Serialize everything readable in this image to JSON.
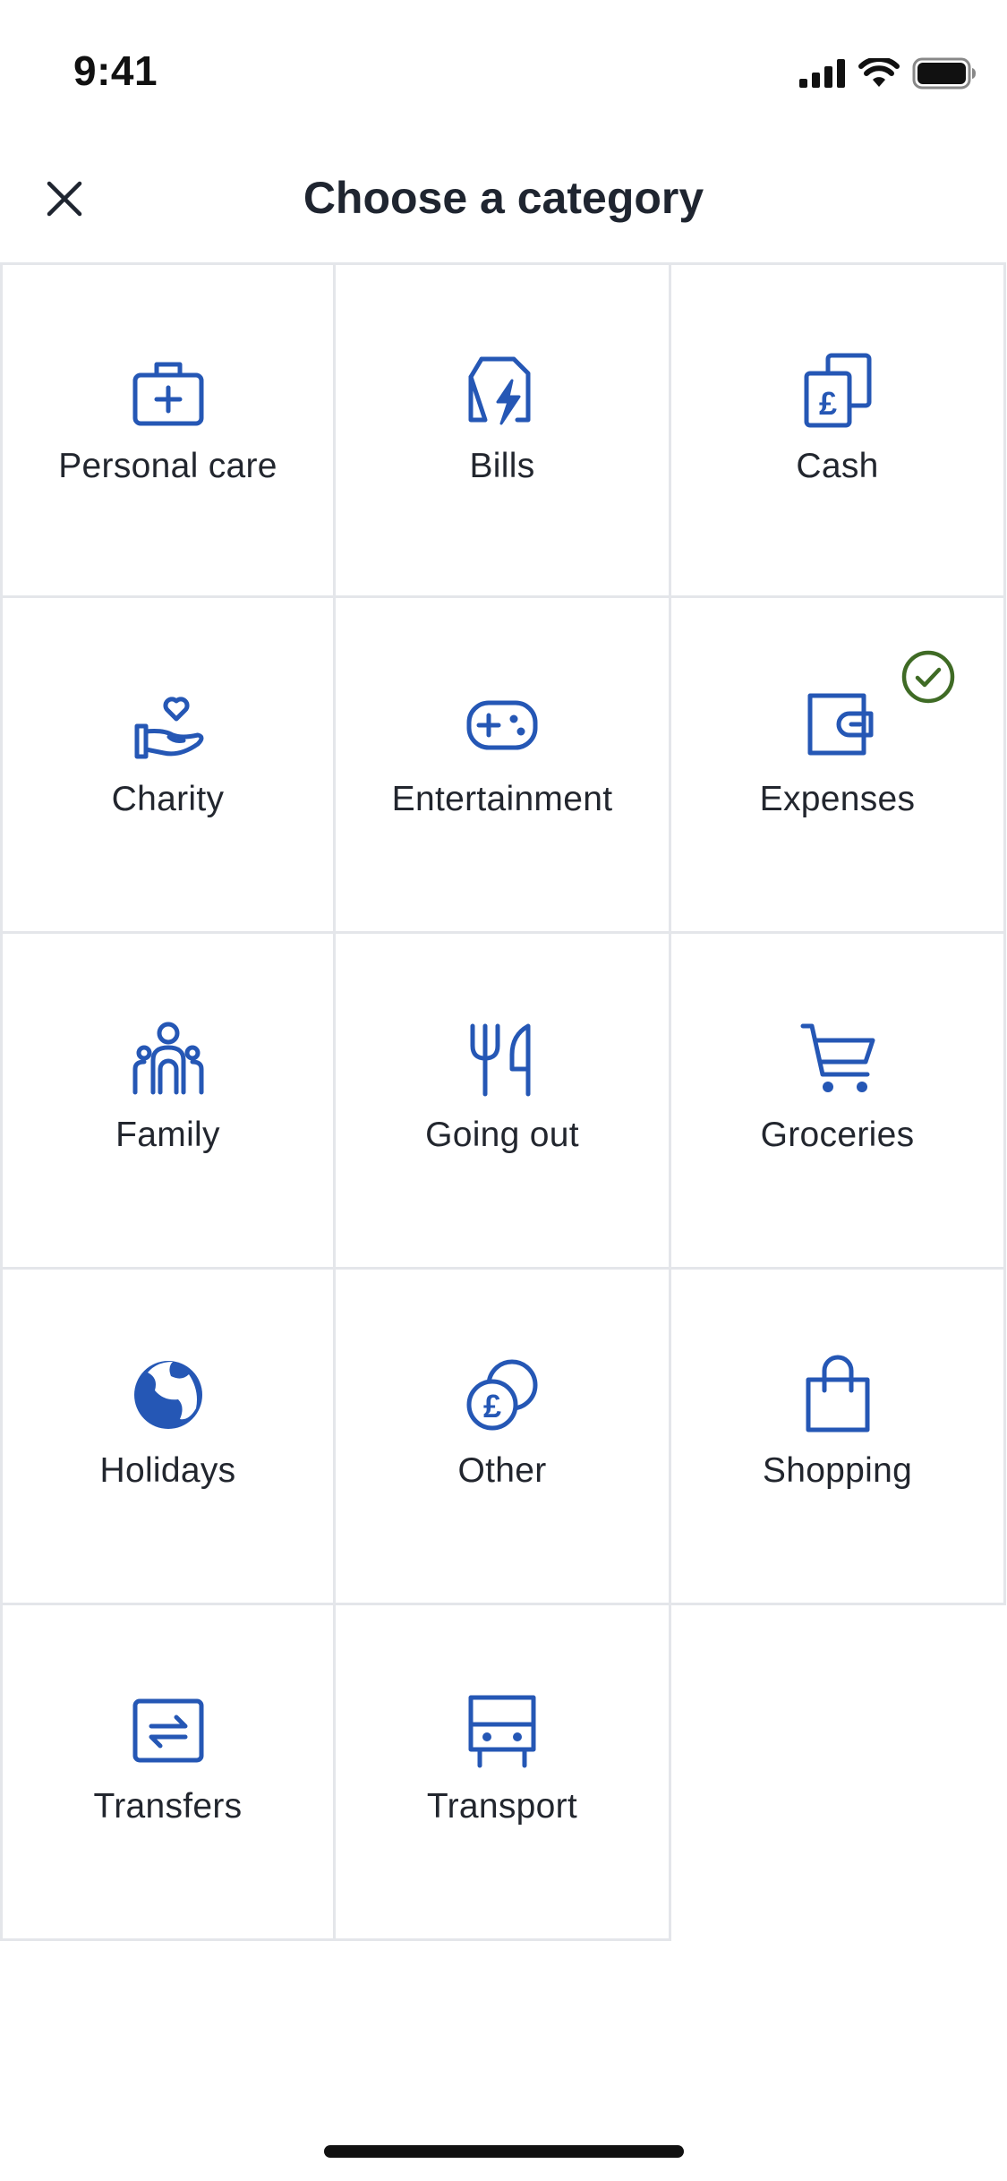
{
  "status_bar": {
    "time": "9:41"
  },
  "header": {
    "title": "Choose a category"
  },
  "colors": {
    "icon_blue": "#2557b5",
    "check_green": "#3f6b25",
    "grid_line": "#e4e6ea"
  },
  "categories": [
    {
      "label": "Personal care",
      "icon": "first-aid-kit-icon",
      "selected": false
    },
    {
      "label": "Bills",
      "icon": "bill-lightning-icon",
      "selected": false
    },
    {
      "label": "Cash",
      "icon": "pound-notes-icon",
      "selected": false
    },
    {
      "label": "Charity",
      "icon": "hand-heart-icon",
      "selected": false
    },
    {
      "label": "Entertainment",
      "icon": "game-controller-icon",
      "selected": false
    },
    {
      "label": "Expenses",
      "icon": "wallet-icon",
      "selected": true
    },
    {
      "label": "Family",
      "icon": "family-icon",
      "selected": false
    },
    {
      "label": "Going out",
      "icon": "fork-knife-icon",
      "selected": false
    },
    {
      "label": "Groceries",
      "icon": "shopping-cart-icon",
      "selected": false
    },
    {
      "label": "Holidays",
      "icon": "globe-icon",
      "selected": false
    },
    {
      "label": "Other",
      "icon": "pound-coins-icon",
      "selected": false
    },
    {
      "label": "Shopping",
      "icon": "shopping-bag-icon",
      "selected": false
    },
    {
      "label": "Transfers",
      "icon": "transfer-arrows-icon",
      "selected": false
    },
    {
      "label": "Transport",
      "icon": "bus-icon",
      "selected": false
    }
  ]
}
